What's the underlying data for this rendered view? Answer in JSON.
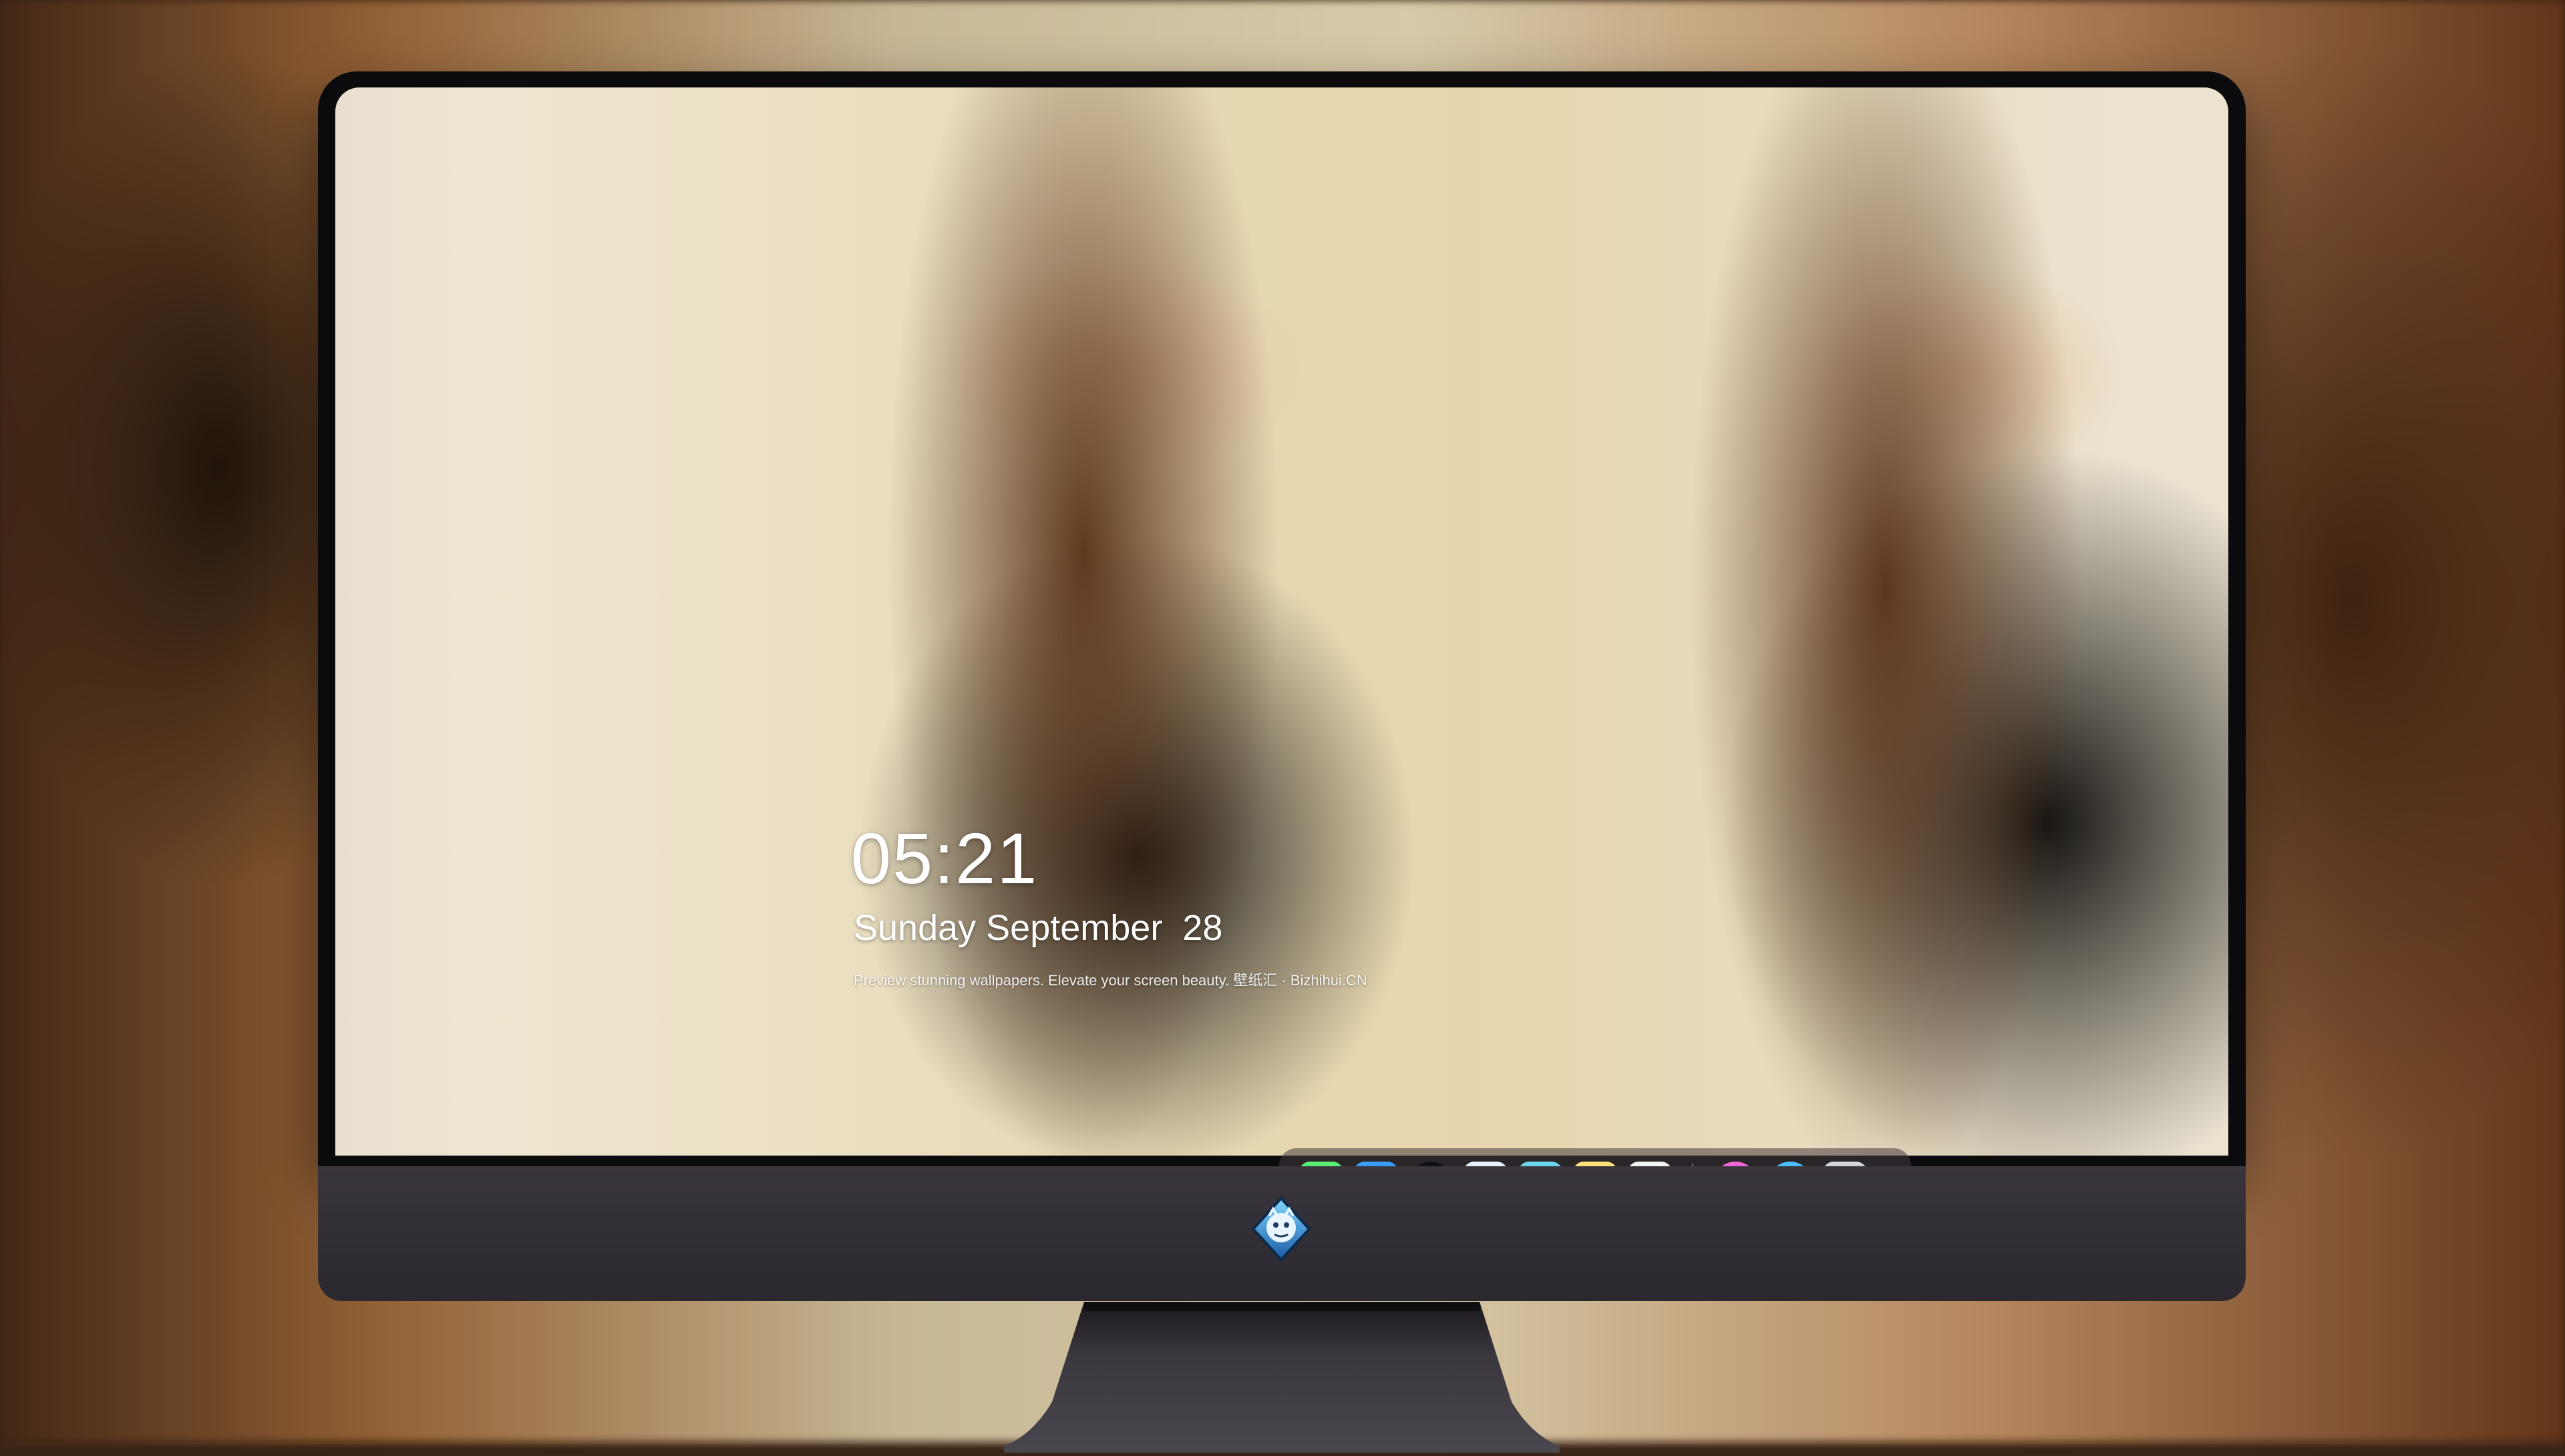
{
  "lockscreen": {
    "time": "05:21",
    "date": "Sunday September  28",
    "tagline": "Preview stunning wallpapers. Elevate your screen beauty. 壁纸汇 · Bizhihui.CN"
  },
  "dock": {
    "apps": [
      {
        "name": "Messages",
        "icon": "messages-icon"
      },
      {
        "name": "Weather",
        "icon": "weather-icon"
      },
      {
        "name": "Clock",
        "icon": "clock-icon"
      },
      {
        "name": "Preview",
        "icon": "preview-icon"
      },
      {
        "name": "Clips",
        "icon": "clapper-icon"
      },
      {
        "name": "Notes",
        "icon": "notes-icon"
      },
      {
        "name": "Photos",
        "icon": "photos-icon"
      },
      {
        "name": "iTunes",
        "icon": "music-icon"
      },
      {
        "name": "App Store",
        "icon": "app-store-icon"
      },
      {
        "name": "Camera",
        "icon": "camera-icon"
      }
    ]
  },
  "colors": {
    "monitor_bezel": "#0b0b0d",
    "monitor_chin": "#332f36",
    "wallpaper_bg": "#e7d6ad"
  }
}
